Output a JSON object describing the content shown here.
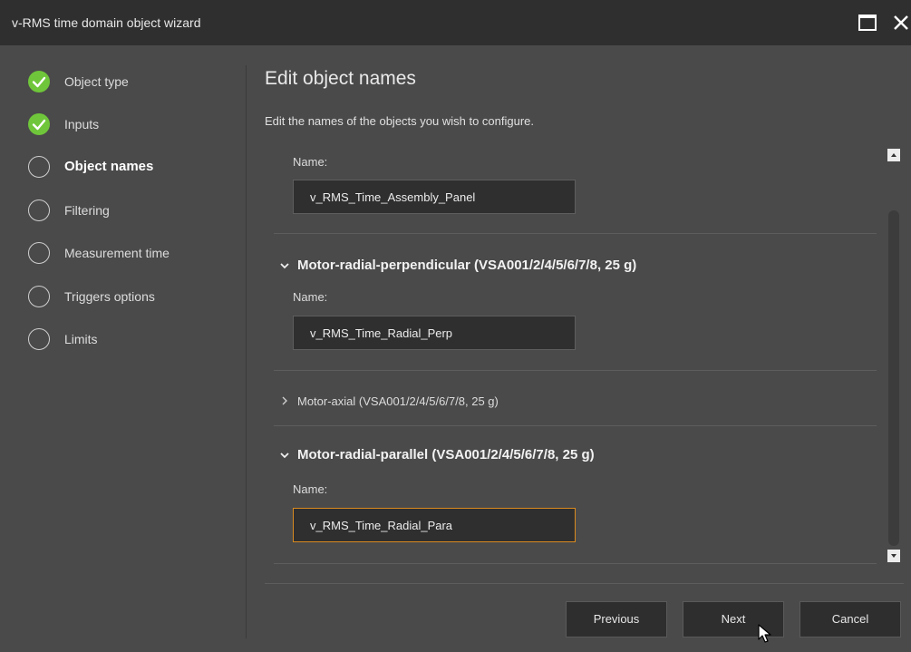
{
  "window": {
    "title": "v-RMS time domain object wizard"
  },
  "steps": [
    {
      "label": "Object type",
      "status": "done"
    },
    {
      "label": "Inputs",
      "status": "done"
    },
    {
      "label": "Object names",
      "status": "active"
    },
    {
      "label": "Filtering",
      "status": "pending"
    },
    {
      "label": "Measurement time",
      "status": "pending"
    },
    {
      "label": "Triggers options",
      "status": "pending"
    },
    {
      "label": "Limits",
      "status": "pending"
    }
  ],
  "main": {
    "title": "Edit object names",
    "description": "Edit the names of the objects you wish to configure."
  },
  "objects": [
    {
      "heading": "",
      "name_label": "Name:",
      "name_value": "v_RMS_Time_Assembly_Panel"
    },
    {
      "heading": "Motor-radial-perpendicular (VSA001/2/4/5/6/7/8, 25 g)",
      "expanded": true,
      "name_label": "Name:",
      "name_value": "v_RMS_Time_Radial_Perp"
    },
    {
      "heading": "Motor-axial (VSA001/2/4/5/6/7/8, 25 g)",
      "expanded": false
    },
    {
      "heading": "Motor-radial-parallel (VSA001/2/4/5/6/7/8, 25 g)",
      "expanded": true,
      "name_label": "Name:",
      "name_value": "v_RMS_Time_Radial_Para",
      "focused": true
    }
  ],
  "buttons": {
    "previous": "Previous",
    "next": "Next",
    "cancel": "Cancel"
  },
  "colors": {
    "check": "#6fc63a",
    "focus_border": "#d98a1f",
    "background": "#4a4a4a",
    "titlebar": "#2f2f2f"
  }
}
